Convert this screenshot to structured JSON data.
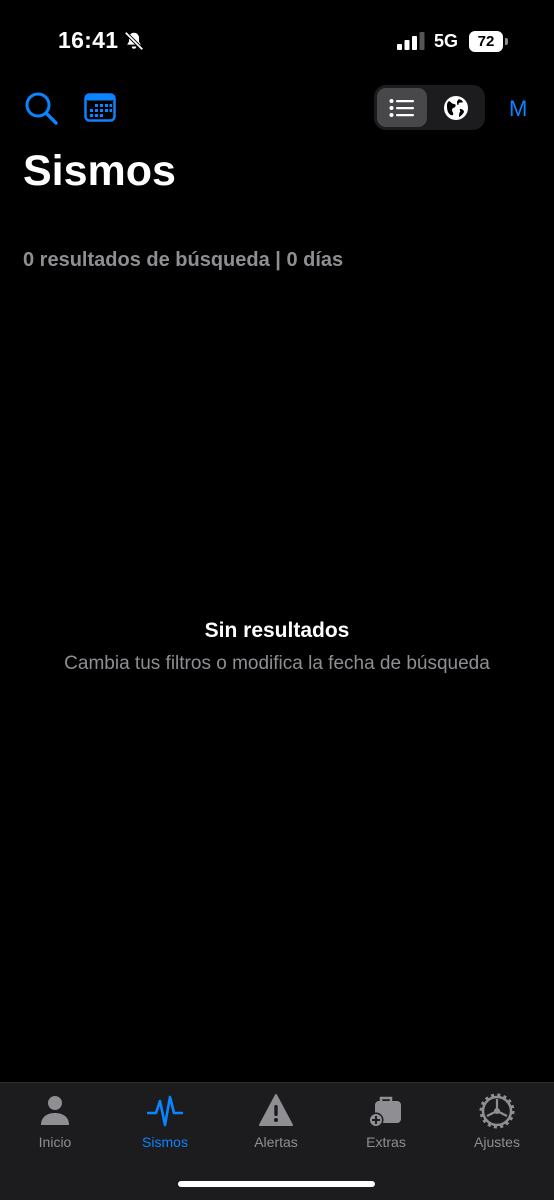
{
  "status_bar": {
    "time": "16:41",
    "network": "5G",
    "battery": "72"
  },
  "toolbar": {
    "icons": [
      "search-icon",
      "calendar-icon",
      "list-icon",
      "globe-icon"
    ],
    "m_label": "M",
    "accent_color": "#0a84ff"
  },
  "page": {
    "title": "Sismos",
    "results_summary": "0 resultados de búsqueda | 0 días",
    "empty_title": "Sin resultados",
    "empty_subtitle": "Cambia tus filtros o modifica la fecha de búsqueda"
  },
  "tabs": [
    {
      "label": "Inicio",
      "icon": "person-icon",
      "active": false
    },
    {
      "label": "Sismos",
      "icon": "waveform-icon",
      "active": true
    },
    {
      "label": "Alertas",
      "icon": "warning-icon",
      "active": false
    },
    {
      "label": "Extras",
      "icon": "briefcase-plus-icon",
      "active": false
    },
    {
      "label": "Ajustes",
      "icon": "gear-icon",
      "active": false
    }
  ]
}
